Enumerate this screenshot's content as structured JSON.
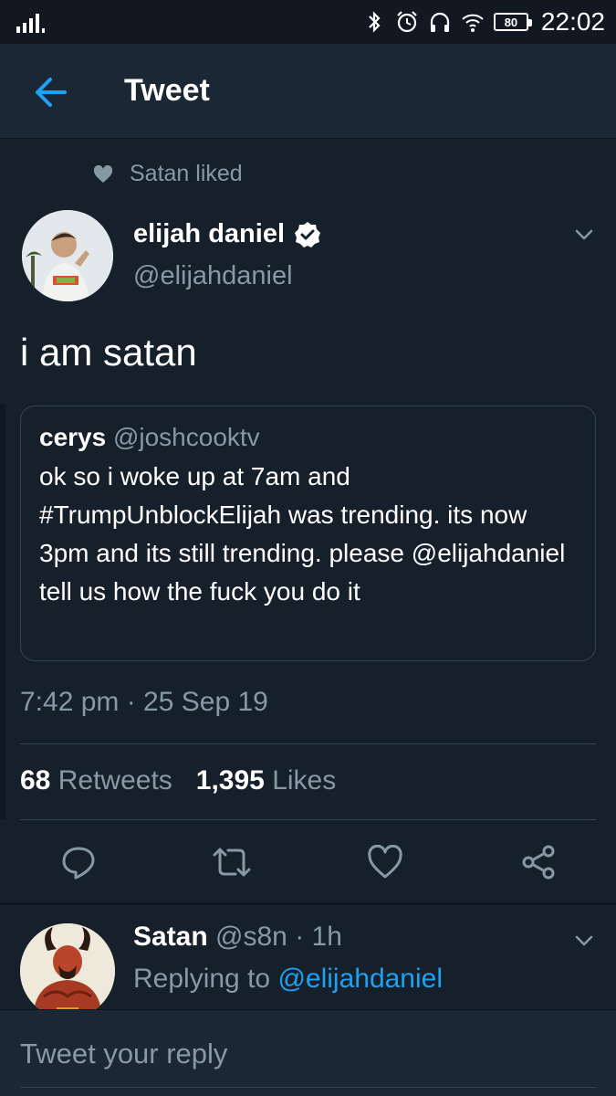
{
  "status_bar": {
    "battery": "80",
    "time": "22:02",
    "icons": [
      "signal-icon",
      "bluetooth-icon",
      "alarm-icon",
      "headphones-icon",
      "wifi-icon",
      "battery-icon"
    ]
  },
  "header": {
    "title": "Tweet",
    "back_icon": "back-arrow-icon"
  },
  "tweet": {
    "social_context": "Satan liked",
    "author_name": "elijah daniel",
    "author_handle": "@elijahdaniel",
    "verified": true,
    "text": "i am satan",
    "quote": {
      "name": "cerys",
      "handle": "@joshcooktv",
      "text": "ok so i woke up at 7am and #TrumpUnblockElijah was trending. its now 3pm and its still trending. please @elijahdaniel tell us how the fuck you do it"
    },
    "timestamp": "7:42 pm · 25 Sep 19",
    "retweets_count": "68",
    "retweets_label": "Retweets",
    "likes_count": "1,395",
    "likes_label": "Likes",
    "actions": [
      "reply-icon",
      "retweet-icon",
      "like-icon",
      "share-icon"
    ]
  },
  "reply": {
    "name": "Satan",
    "handle": "@s8n",
    "time": "· 1h",
    "replying_prefix": "Replying to",
    "replying_to": "@elijahdaniel"
  },
  "composer": {
    "placeholder": "Tweet your reply"
  },
  "colors": {
    "background": "#16202b",
    "header": "#1b2735",
    "secondary_text": "#8899a6",
    "accent": "#1da1f2",
    "border": "#38444d"
  }
}
